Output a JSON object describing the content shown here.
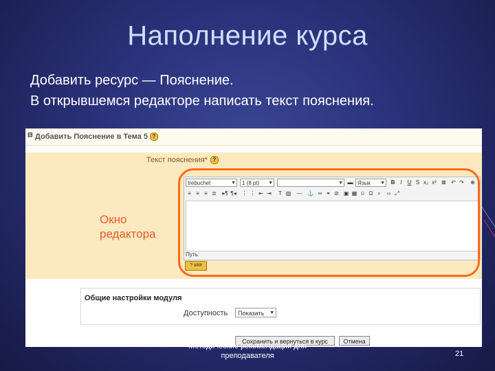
{
  "slide": {
    "title": "Наполнение курса",
    "line1": "Добавить ресурс — Пояснение.",
    "line2": "В открывшемся редакторе написать текст пояснения.",
    "footer": "Методические рекомендации для преподавателя",
    "page_number": "21"
  },
  "screenshot": {
    "header_title": "Добавить Пояснение в Тема 5",
    "field_label": "Текст пояснения*",
    "annotation": {
      "line1": "Окно",
      "line2": "редактора"
    },
    "toolbar": {
      "font": "trebuchet",
      "size": "1 (8 pt)",
      "style": "",
      "lang": "Язык"
    },
    "path_label": "Путь:",
    "section_title": "Общие настройки модуля",
    "access_label": "Доступность",
    "access_value": "Показать",
    "save_button": "Сохранить и вернуться в курс",
    "cancel_button": "Отмена"
  },
  "colors": {
    "annotation": "#e45a2a",
    "highlight": "#ff6a1a",
    "form_bg": "#fde9bf"
  }
}
